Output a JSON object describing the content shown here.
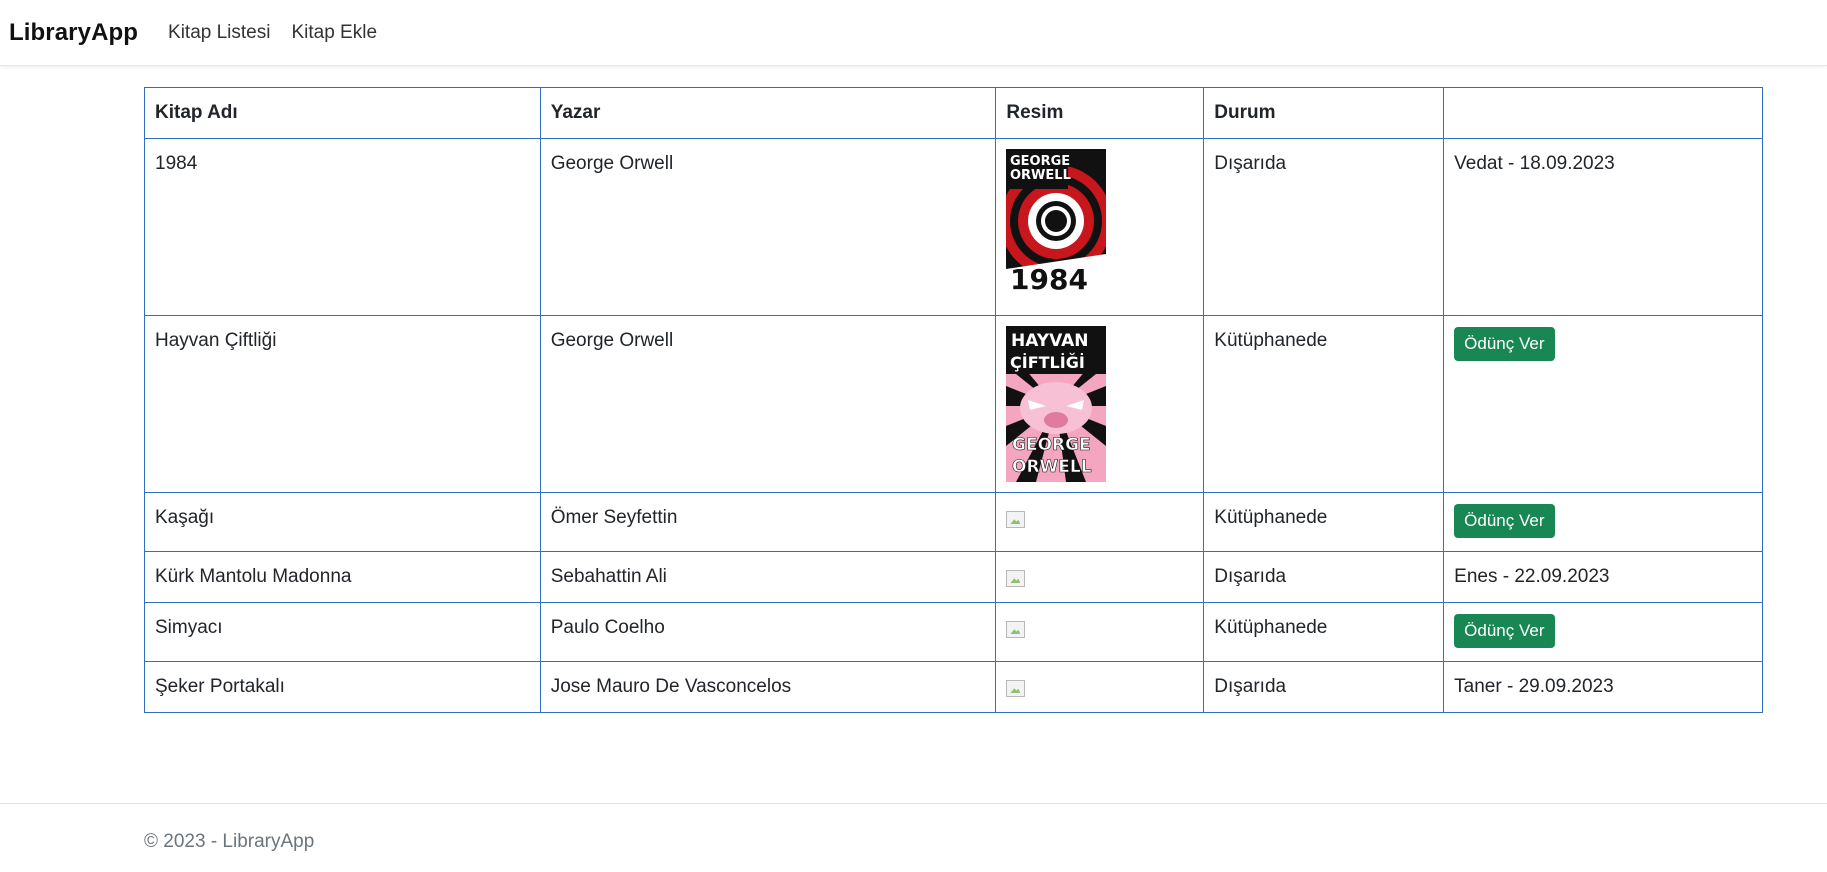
{
  "navbar": {
    "brand": "LibraryApp",
    "links": [
      "Kitap Listesi",
      "Kitap Ekle"
    ]
  },
  "table": {
    "headers": [
      "Kitap Adı",
      "Yazar",
      "Resim",
      "Durum",
      ""
    ],
    "rows": [
      {
        "title": "1984",
        "author": "George Orwell",
        "image": "cover-1984",
        "status": "Dışarıda",
        "action": "Vedat - 18.09.2023"
      },
      {
        "title": "Hayvan Çiftliği",
        "author": "George Orwell",
        "image": "cover-hayvan-ciftligi",
        "status": "Kütüphanede",
        "action": "Ödünç Ver"
      },
      {
        "title": "Kaşağı",
        "author": "Ömer Seyfettin",
        "image": "broken-image",
        "status": "Kütüphanede",
        "action": "Ödünç Ver"
      },
      {
        "title": "Kürk Mantolu Madonna",
        "author": "Sebahattin Ali",
        "image": "broken-image",
        "status": "Dışarıda",
        "action": "Enes - 22.09.2023"
      },
      {
        "title": "Simyacı",
        "author": "Paulo Coelho",
        "image": "broken-image",
        "status": "Kütüphanede",
        "action": "Ödünç Ver"
      },
      {
        "title": "Şeker Portakalı",
        "author": "Jose Mauro De Vasconcelos",
        "image": "broken-image",
        "status": "Dışarıda",
        "action": "Taner - 29.09.2023"
      }
    ]
  },
  "covers": {
    "cover_1984": {
      "author_line1": "GEORGE",
      "author_line2": "ORWELL",
      "title": "1984"
    },
    "cover_hayvan": {
      "title_line1": "HAYVAN",
      "title_line2": "ÇİFTLİĞİ",
      "author_line1": "GEORGE",
      "author_line2": "ORWELL"
    }
  },
  "footer": {
    "text": "© 2023 - LibraryApp"
  },
  "colors": {
    "table_border": "#2f6fbf",
    "button_bg": "#198754",
    "footer_text": "#6c757d"
  }
}
